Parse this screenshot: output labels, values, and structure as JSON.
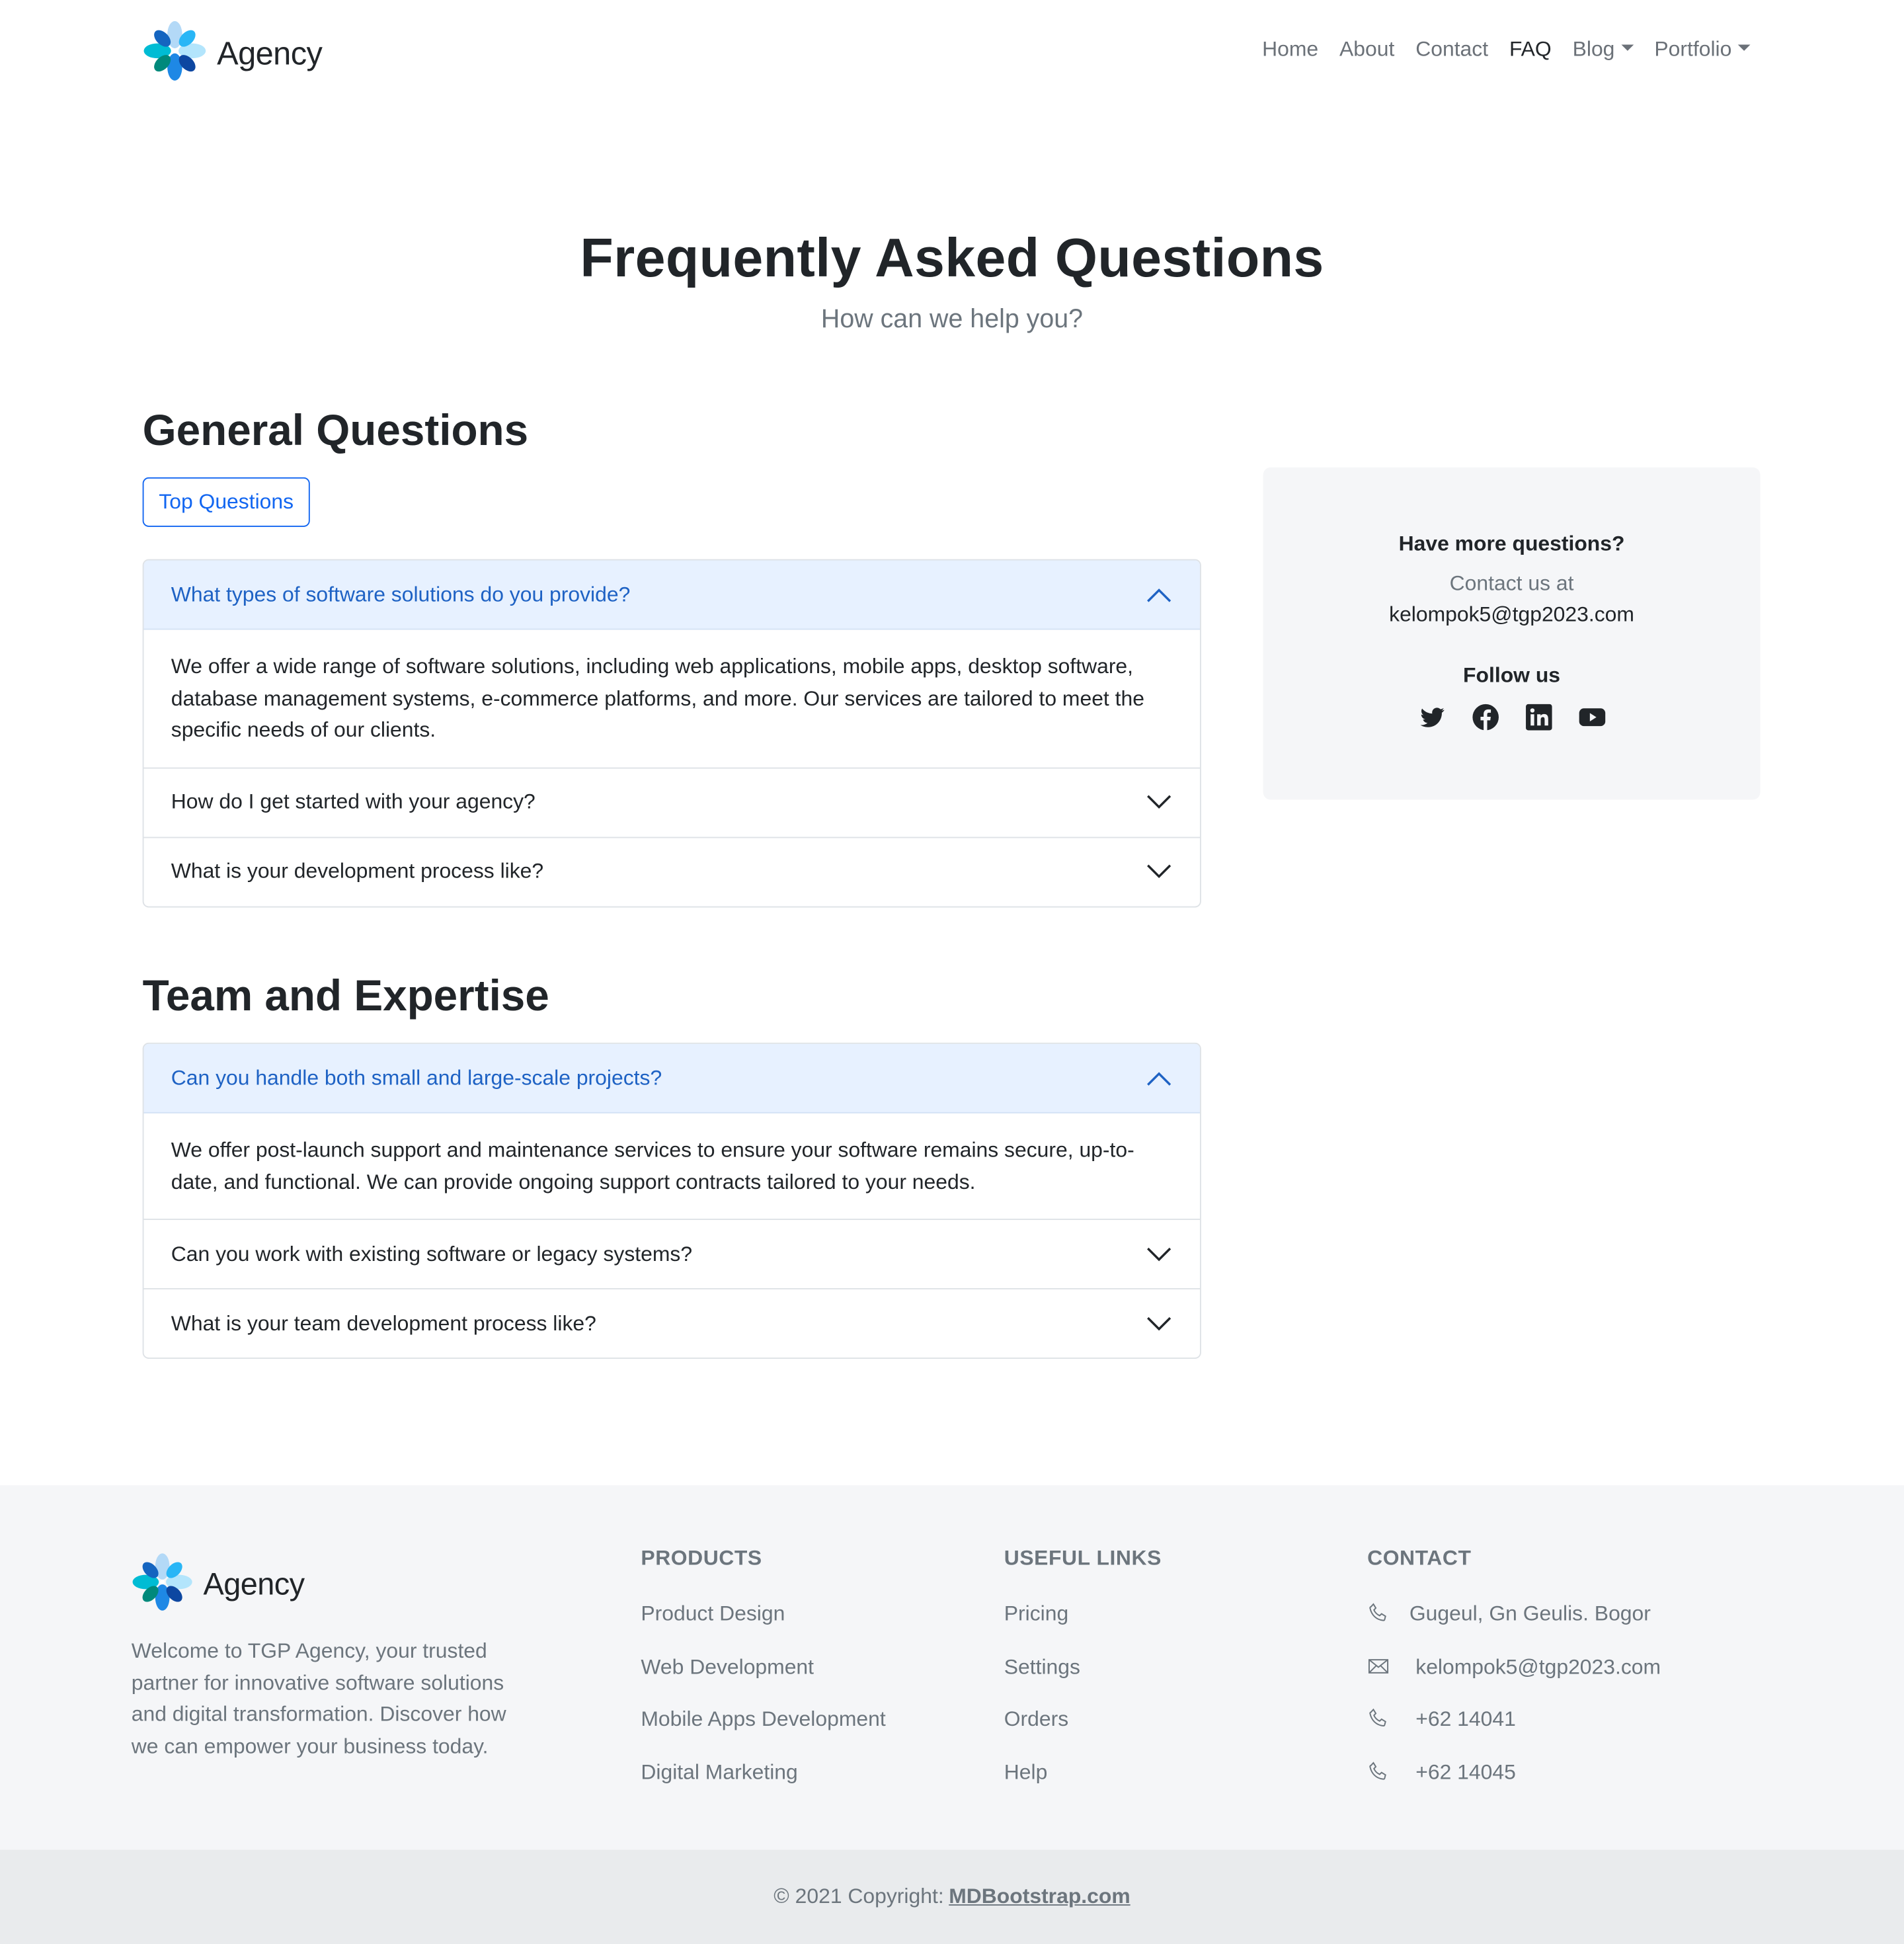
{
  "nav": {
    "brand": "Agency",
    "links": [
      {
        "label": "Home"
      },
      {
        "label": "About"
      },
      {
        "label": "Contact"
      },
      {
        "label": "FAQ"
      },
      {
        "label": "Blog"
      },
      {
        "label": "Portfolio"
      }
    ]
  },
  "hero": {
    "title": "Frequently Asked Questions",
    "subtitle": "How can we help you?"
  },
  "general": {
    "title": "General Questions",
    "button": "Top Questions",
    "items": [
      {
        "q": "What types of software solutions do you provide?",
        "a": "We offer a wide range of software solutions, including web applications, mobile apps, desktop software, database management systems, e-commerce platforms, and more. Our services are tailored to meet the specific needs of our clients."
      },
      {
        "q": "How do I get started with your agency?"
      },
      {
        "q": "What is your development process like?"
      }
    ]
  },
  "team": {
    "title": "Team and Expertise",
    "items": [
      {
        "q": "Can you handle both small and large-scale projects?",
        "a": "We offer post-launch support and maintenance services to ensure your software remains secure, up-to-date, and functional. We can provide ongoing support contracts tailored to your needs."
      },
      {
        "q": "Can you work with existing software or legacy systems?"
      },
      {
        "q": "What is your team development process like?"
      }
    ]
  },
  "sidebar": {
    "heading": "Have more questions?",
    "contact_text": "Contact us at",
    "email": "kelompok5@tgp2023.com",
    "follow": "Follow us",
    "social_icons": [
      "twitter-icon",
      "facebook-icon",
      "linkedin-icon",
      "youtube-icon"
    ]
  },
  "footer": {
    "brand": "Agency",
    "description": "Welcome to TGP Agency, your trusted partner for innovative software solutions and digital transformation. Discover how we can empower your business today.",
    "products": {
      "title": "PRODUCTS",
      "links": [
        "Product Design",
        "Web Development",
        "Mobile Apps Development",
        "Digital Marketing"
      ]
    },
    "useful": {
      "title": "USEFUL LINKS",
      "links": [
        "Pricing",
        "Settings",
        "Orders",
        "Help"
      ]
    },
    "contact": {
      "title": "CONTACT",
      "items": [
        {
          "icon": "phone-icon",
          "text": "Gugeul, Gn Geulis. Bogor"
        },
        {
          "icon": "envelope-icon",
          "text": "kelompok5@tgp2023.com"
        },
        {
          "icon": "phone-icon",
          "text": "+62 14041"
        },
        {
          "icon": "phone-icon",
          "text": "+62 14045"
        }
      ]
    },
    "copyright_prefix": "© 2021 Copyright:",
    "copyright_link": "MDBootstrap.com"
  },
  "colors": {
    "accent": "#1266f1",
    "accordion_open_bg": "#e7f1ff",
    "footer_bg": "#f5f6f8"
  }
}
